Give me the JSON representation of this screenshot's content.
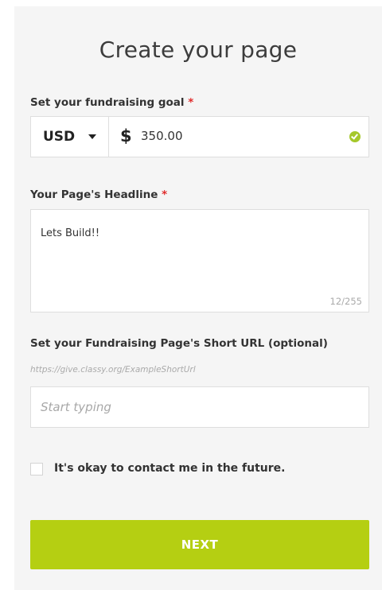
{
  "page": {
    "title": "Create your page"
  },
  "goal": {
    "label": "Set your fundraising goal",
    "required_mark": "*",
    "currency": "USD",
    "currency_symbol": "$",
    "amount": "350.00"
  },
  "headline": {
    "label": "Your Page's Headline",
    "required_mark": "*",
    "value": "Lets Build!!",
    "counter": "12/255"
  },
  "short_url": {
    "label": "Set your Fundraising Page's Short URL (optional)",
    "hint": "https://give.classy.org/ExampleShortUrl",
    "placeholder": "Start typing"
  },
  "contact": {
    "label": "It's okay to contact me in the future.",
    "checked": false
  },
  "actions": {
    "next_label": "NEXT"
  },
  "colors": {
    "accent": "#b5cf12",
    "valid": "#a5c82a",
    "required": "#e02b2b"
  },
  "icons": [
    "chevron-down-icon",
    "check-circle-icon"
  ]
}
